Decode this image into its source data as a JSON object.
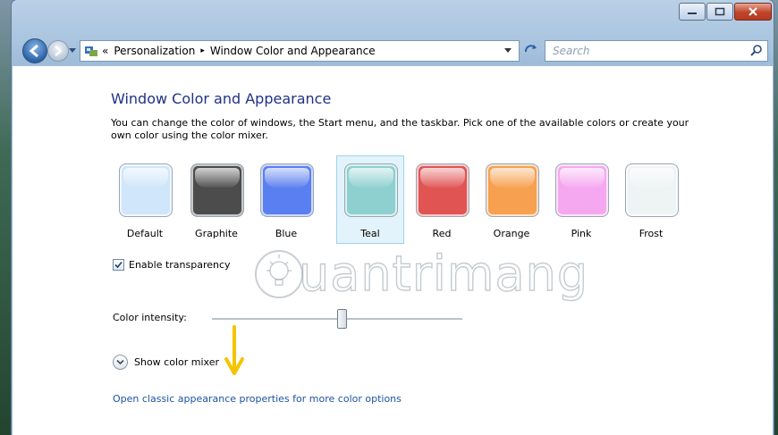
{
  "window": {
    "caption_buttons": [
      "minimize-icon",
      "maximize-icon",
      "close-icon"
    ]
  },
  "navbar": {
    "breadcrumb_prefix": "«",
    "breadcrumbs": [
      "Personalization",
      "Window Color and Appearance"
    ],
    "separator": "▸",
    "search_placeholder": "Search"
  },
  "page": {
    "title": "Window Color and Appearance",
    "description": "You can change the color of windows, the Start menu, and the taskbar. Pick one of the available colors or create your own color using the color mixer."
  },
  "swatches": [
    {
      "label": "Default",
      "color": "#cfe6fb",
      "selected": false
    },
    {
      "label": "Graphite",
      "color": "#4c4c4c",
      "selected": false
    },
    {
      "label": "Blue",
      "color": "#5a7ff0",
      "selected": false
    },
    {
      "label": "Teal",
      "color": "#8ed0d0",
      "selected": true
    },
    {
      "label": "Red",
      "color": "#e05454",
      "selected": false
    },
    {
      "label": "Orange",
      "color": "#f7a050",
      "selected": false
    },
    {
      "label": "Pink",
      "color": "#f5a8f0",
      "selected": false
    },
    {
      "label": "Frost",
      "color": "#eef4f4",
      "selected": false
    }
  ],
  "transparency": {
    "label": "Enable transparency",
    "checked": true
  },
  "intensity": {
    "label": "Color intensity:",
    "value": 0.52
  },
  "mixer": {
    "label": "Show color mixer"
  },
  "classic_link": "Open classic appearance properties for more color options",
  "watermark": {
    "text": "uantrimang"
  },
  "colors": {
    "accent_link": "#1e52a6",
    "title": "#1e3287",
    "arrow": "#f5c400"
  }
}
